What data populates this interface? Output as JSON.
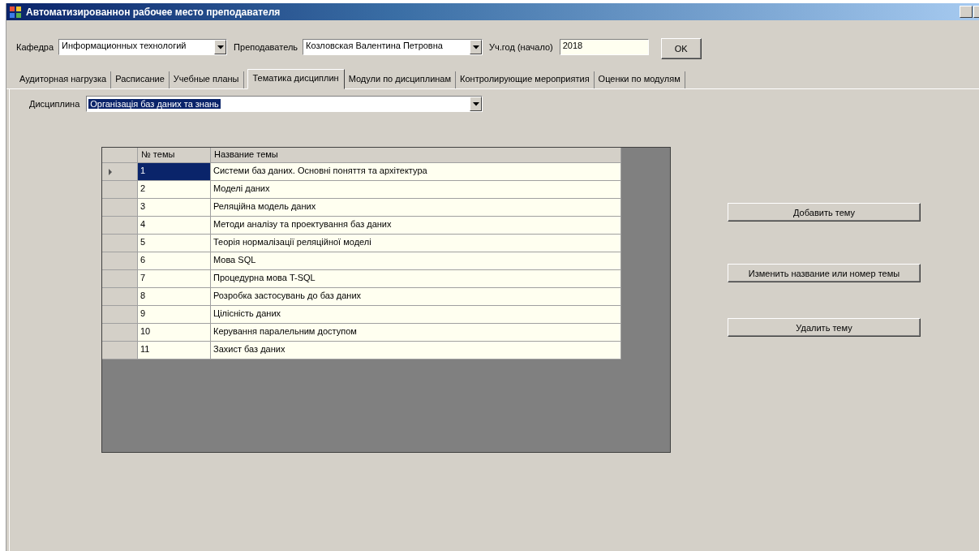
{
  "window": {
    "title": "Автоматизированнон рабочее место преподавателя"
  },
  "filters": [
    {
      "label": "Кафедра",
      "kind": "combo",
      "value": "Информационных технологий"
    },
    {
      "label": "Преподаватель",
      "kind": "combo",
      "value": "Козловская Валентина Петровна"
    },
    {
      "label": "Уч.год (начало)",
      "kind": "text",
      "value": "2018"
    }
  ],
  "ok_button": "OK",
  "tabs": [
    {
      "label": "Аудиторная нагрузка",
      "selected": false
    },
    {
      "label": "Расписание",
      "selected": false
    },
    {
      "label": "Учебные планы",
      "selected": false
    },
    {
      "label": "Тематика дисциплин",
      "selected": true
    },
    {
      "label": "Модули по дисциплинам",
      "selected": false
    },
    {
      "label": "Контролирующие мероприятия",
      "selected": false
    },
    {
      "label": "Оценки по модулям",
      "selected": false
    }
  ],
  "discipline": {
    "label": "Дисциплина",
    "value": "Організація баз даних та знань"
  },
  "table": {
    "columns": [
      "№ темы",
      "Название темы"
    ],
    "rows": [
      {
        "cells": [
          "1",
          "Системи баз даних. Основні поняття та архітектура"
        ],
        "selected": true
      },
      {
        "cells": [
          "2",
          "Моделі  даних"
        ],
        "selected": false
      },
      {
        "cells": [
          "3",
          "Реляційна модель даних"
        ],
        "selected": false
      },
      {
        "cells": [
          "4",
          "Методи аналізу та проектування баз даних"
        ],
        "selected": false
      },
      {
        "cells": [
          "5",
          "Теорія нормалізації реляційної моделі"
        ],
        "selected": false
      },
      {
        "cells": [
          "6",
          "Мова SQL"
        ],
        "selected": false
      },
      {
        "cells": [
          "7",
          "Процедурна мова T-SQL"
        ],
        "selected": false
      },
      {
        "cells": [
          "8",
          "Розробка застосувань до баз даних"
        ],
        "selected": false
      },
      {
        "cells": [
          "9",
          "Цілісність даних"
        ],
        "selected": false
      },
      {
        "cells": [
          "10",
          "Керування паралельним доступом"
        ],
        "selected": false
      },
      {
        "cells": [
          "11",
          "Захист баз даних"
        ],
        "selected": false
      }
    ]
  },
  "actions": [
    "Добавить тему",
    "Изменить название или номер темы",
    "Удалить тему"
  ]
}
